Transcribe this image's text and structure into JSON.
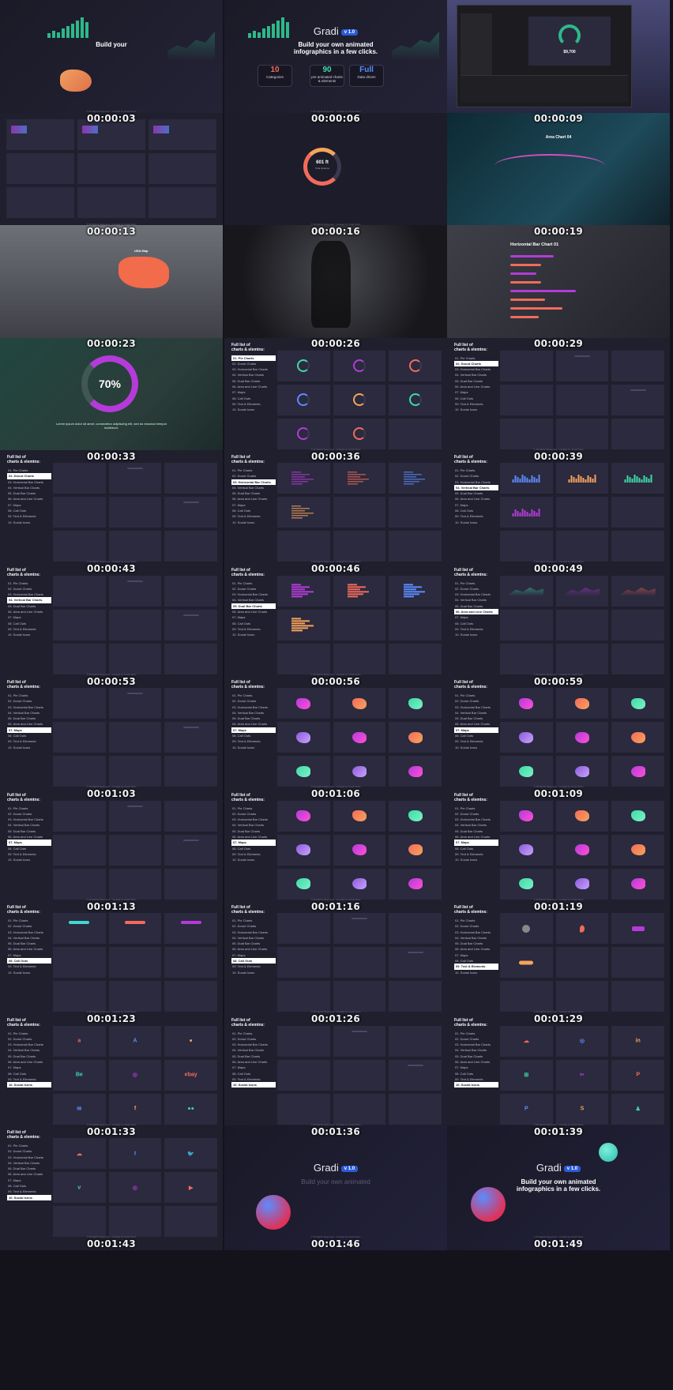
{
  "app": {
    "brand": "Gradi",
    "version": "v 1.0",
    "tagline_full": "Build your own animated infographics in a few clicks.",
    "tagline_partial": "Build your",
    "tagline_faint": "Build your own animated",
    "footer_text": "© All Rights Reserved · Created by Gradi Team"
  },
  "stats": [
    {
      "value": "10",
      "label": "Categories",
      "color": "#f26b5b"
    },
    {
      "value": "90",
      "label": "pre animated charts & elements",
      "color": "#3fd9a8"
    },
    {
      "value": "Full",
      "label": "Data driven",
      "color": "#5b8cff"
    }
  ],
  "list": {
    "title_line1": "Full list of",
    "title_line2": "charts & elemtns:",
    "items": [
      "01. Pie Charts",
      "02. Donut Charts",
      "03. Horizontal Bar Charts",
      "04. Vertical Bar Charts",
      "05. Dual Bar Charts",
      "06. Area and Line Charts",
      "07. Maps",
      "08. Call Outs",
      "09. Text & Elements",
      "10. Social Icons"
    ]
  },
  "scenes": {
    "speed": {
      "value": "$9,700",
      "sub": "Total sales"
    },
    "gauge": {
      "value": "601 ft",
      "sub": "Total distance"
    },
    "area": {
      "title": "Area Chart 04"
    },
    "usa": {
      "title": "USA Map"
    },
    "hbar": {
      "title": "Horizontal Bar Chart 01"
    },
    "donut": {
      "value": "70%",
      "text": "Lorem ipsum dolor sit amet, consectetur adipiscing elit, sed do eiusmod tempor incididunt."
    }
  },
  "frames": [
    {
      "time": "00:00:03",
      "kind": "intro",
      "active": -1
    },
    {
      "time": "00:00:06",
      "kind": "intro-full",
      "active": -1
    },
    {
      "time": "00:00:09",
      "kind": "editor",
      "active": -1
    },
    {
      "time": "00:00:13",
      "kind": "dashboard",
      "active": -1
    },
    {
      "time": "00:00:16",
      "kind": "gauge",
      "active": -1
    },
    {
      "time": "00:00:19",
      "kind": "area",
      "active": -1
    },
    {
      "time": "00:00:23",
      "kind": "usa",
      "active": -1
    },
    {
      "time": "00:00:26",
      "kind": "gym",
      "active": -1
    },
    {
      "time": "00:00:29",
      "kind": "hbar",
      "active": -1
    },
    {
      "time": "00:00:33",
      "kind": "donut",
      "active": -1
    },
    {
      "time": "00:00:36",
      "kind": "list",
      "active": 0,
      "tiles": "pie"
    },
    {
      "time": "00:00:39",
      "kind": "list",
      "active": 1,
      "tiles": "faint"
    },
    {
      "time": "00:00:43",
      "kind": "list",
      "active": 1,
      "tiles": "faint"
    },
    {
      "time": "00:00:46",
      "kind": "list",
      "active": 2,
      "tiles": "hbars"
    },
    {
      "time": "00:00:49",
      "kind": "list",
      "active": 3,
      "tiles": "vbars"
    },
    {
      "time": "00:00:53",
      "kind": "list",
      "active": 3,
      "tiles": "faint"
    },
    {
      "time": "00:00:56",
      "kind": "list",
      "active": 4,
      "tiles": "hbars"
    },
    {
      "time": "00:00:59",
      "kind": "list",
      "active": 5,
      "tiles": "area"
    },
    {
      "time": "00:01:03",
      "kind": "list",
      "active": 6,
      "tiles": "faint"
    },
    {
      "time": "00:01:06",
      "kind": "list",
      "active": 6,
      "tiles": "maps"
    },
    {
      "time": "00:01:09",
      "kind": "list",
      "active": 6,
      "tiles": "maps"
    },
    {
      "time": "00:01:13",
      "kind": "list",
      "active": 6,
      "tiles": "faint"
    },
    {
      "time": "00:01:16",
      "kind": "list",
      "active": 6,
      "tiles": "maps"
    },
    {
      "time": "00:01:19",
      "kind": "list",
      "active": 6,
      "tiles": "maps"
    },
    {
      "time": "00:01:23",
      "kind": "list",
      "active": 7,
      "tiles": "callouts"
    },
    {
      "time": "00:01:26",
      "kind": "list",
      "active": 7,
      "tiles": "faint"
    },
    {
      "time": "00:01:29",
      "kind": "list",
      "active": 8,
      "tiles": "elements"
    },
    {
      "time": "00:01:33",
      "kind": "list",
      "active": 9,
      "tiles": "social1"
    },
    {
      "time": "00:01:36",
      "kind": "list",
      "active": 9,
      "tiles": "faint"
    },
    {
      "time": "00:01:39",
      "kind": "list",
      "active": 9,
      "tiles": "social2"
    },
    {
      "time": "00:01:43",
      "kind": "list",
      "active": 9,
      "tiles": "social3"
    },
    {
      "time": "00:01:46",
      "kind": "outro-faint",
      "active": -1
    },
    {
      "time": "00:01:49",
      "kind": "outro",
      "active": -1
    }
  ],
  "social_icons": {
    "social1": [
      "a",
      "A",
      "●",
      "Be",
      "◎",
      "ebay",
      "✉",
      "f",
      "●●"
    ],
    "social2": [
      "☁",
      "◎",
      "in",
      "⊞",
      "✂",
      "P",
      "P",
      "S",
      "♟"
    ],
    "social3": [
      "☁",
      "t",
      "🐦",
      "v",
      "◎",
      "▶",
      "",
      "",
      ""
    ]
  },
  "colors": {
    "bg": "#14131c",
    "panel": "#201f2e",
    "tile": "#2b2a3e",
    "accent_blue": "#2a5bd7",
    "accent_green": "#2db98a",
    "accent_purple": "#b43bd9",
    "accent_coral": "#f26b5b"
  }
}
